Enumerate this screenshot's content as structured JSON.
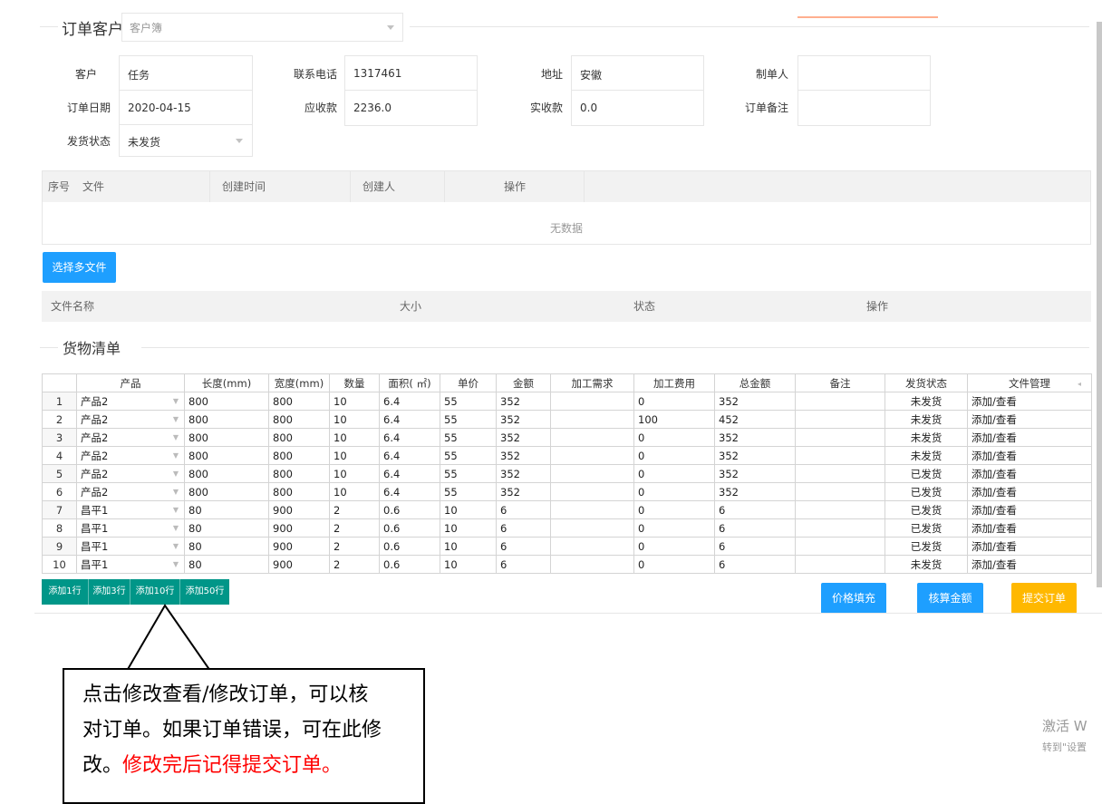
{
  "header": {
    "legend": "订单客户",
    "customer_select_placeholder": "客户簿"
  },
  "form": {
    "customer_label": "客户",
    "customer_value": "任务",
    "phone_label": "联系电话",
    "phone_value": "1317461",
    "address_label": "地址",
    "address_value": "安徽",
    "maker_label": "制单人",
    "maker_value": "",
    "date_label": "订单日期",
    "date_value": "2020-04-15",
    "receivable_label": "应收款",
    "receivable_value": "2236.0",
    "received_label": "实收款",
    "received_value": "0.0",
    "note_label": "订单备注",
    "note_value": "",
    "ship_label": "发货状态",
    "ship_value": "未发货"
  },
  "files": {
    "headers": [
      "序号",
      "文件",
      "创建时间",
      "创建人",
      "操作"
    ],
    "empty": "无数据",
    "select_button": "选择多文件",
    "upload_headers": [
      "文件名称",
      "大小",
      "状态",
      "操作"
    ]
  },
  "goods": {
    "legend": "货物清单",
    "headers": [
      "",
      "产品",
      "长度(mm)",
      "宽度(mm)",
      "数量",
      "面积( ㎡)",
      "单价",
      "金额",
      "加工需求",
      "加工费用",
      "总金额",
      "备注",
      "发货状态",
      "文件管理"
    ],
    "rows": [
      [
        "1",
        "产品2",
        "800",
        "800",
        "10",
        "6.4",
        "55",
        "352",
        "",
        "0",
        "352",
        "",
        "未发货",
        "添加/查看"
      ],
      [
        "2",
        "产品2",
        "800",
        "800",
        "10",
        "6.4",
        "55",
        "352",
        "",
        "100",
        "452",
        "",
        "未发货",
        "添加/查看"
      ],
      [
        "3",
        "产品2",
        "800",
        "800",
        "10",
        "6.4",
        "55",
        "352",
        "",
        "0",
        "352",
        "",
        "未发货",
        "添加/查看"
      ],
      [
        "4",
        "产品2",
        "800",
        "800",
        "10",
        "6.4",
        "55",
        "352",
        "",
        "0",
        "352",
        "",
        "未发货",
        "添加/查看"
      ],
      [
        "5",
        "产品2",
        "800",
        "800",
        "10",
        "6.4",
        "55",
        "352",
        "",
        "0",
        "352",
        "",
        "已发货",
        "添加/查看"
      ],
      [
        "6",
        "产品2",
        "800",
        "800",
        "10",
        "6.4",
        "55",
        "352",
        "",
        "0",
        "352",
        "",
        "已发货",
        "添加/查看"
      ],
      [
        "7",
        "昌平1",
        "80",
        "900",
        "2",
        "0.6",
        "10",
        "6",
        "",
        "0",
        "6",
        "",
        "已发货",
        "添加/查看"
      ],
      [
        "8",
        "昌平1",
        "80",
        "900",
        "2",
        "0.6",
        "10",
        "6",
        "",
        "0",
        "6",
        "",
        "已发货",
        "添加/查看"
      ],
      [
        "9",
        "昌平1",
        "80",
        "900",
        "2",
        "0.6",
        "10",
        "6",
        "",
        "0",
        "6",
        "",
        "已发货",
        "添加/查看"
      ],
      [
        "10",
        "昌平1",
        "80",
        "900",
        "2",
        "0.6",
        "10",
        "6",
        "",
        "0",
        "6",
        "",
        "未发货",
        "添加/查看"
      ]
    ],
    "add_buttons": [
      "添加1行",
      "添加3行",
      "添加10行",
      "添加50行"
    ],
    "price_fill": "价格填充",
    "calc_amount": "核算金额",
    "submit": "提交订单"
  },
  "callout": {
    "line1": "点击修改查看/修改订单，可以核",
    "line2": "对订单。如果订单错误，可在此修",
    "line3_black": "改。",
    "line3_red": "修改完后记得提交订单。"
  },
  "watermark": {
    "line1": "激活 W",
    "line2": "转到\"设置"
  },
  "colors": {
    "blue": "#1E9FFF",
    "orange": "#FFB800",
    "green": "#009688",
    "red": "#ff0000"
  }
}
